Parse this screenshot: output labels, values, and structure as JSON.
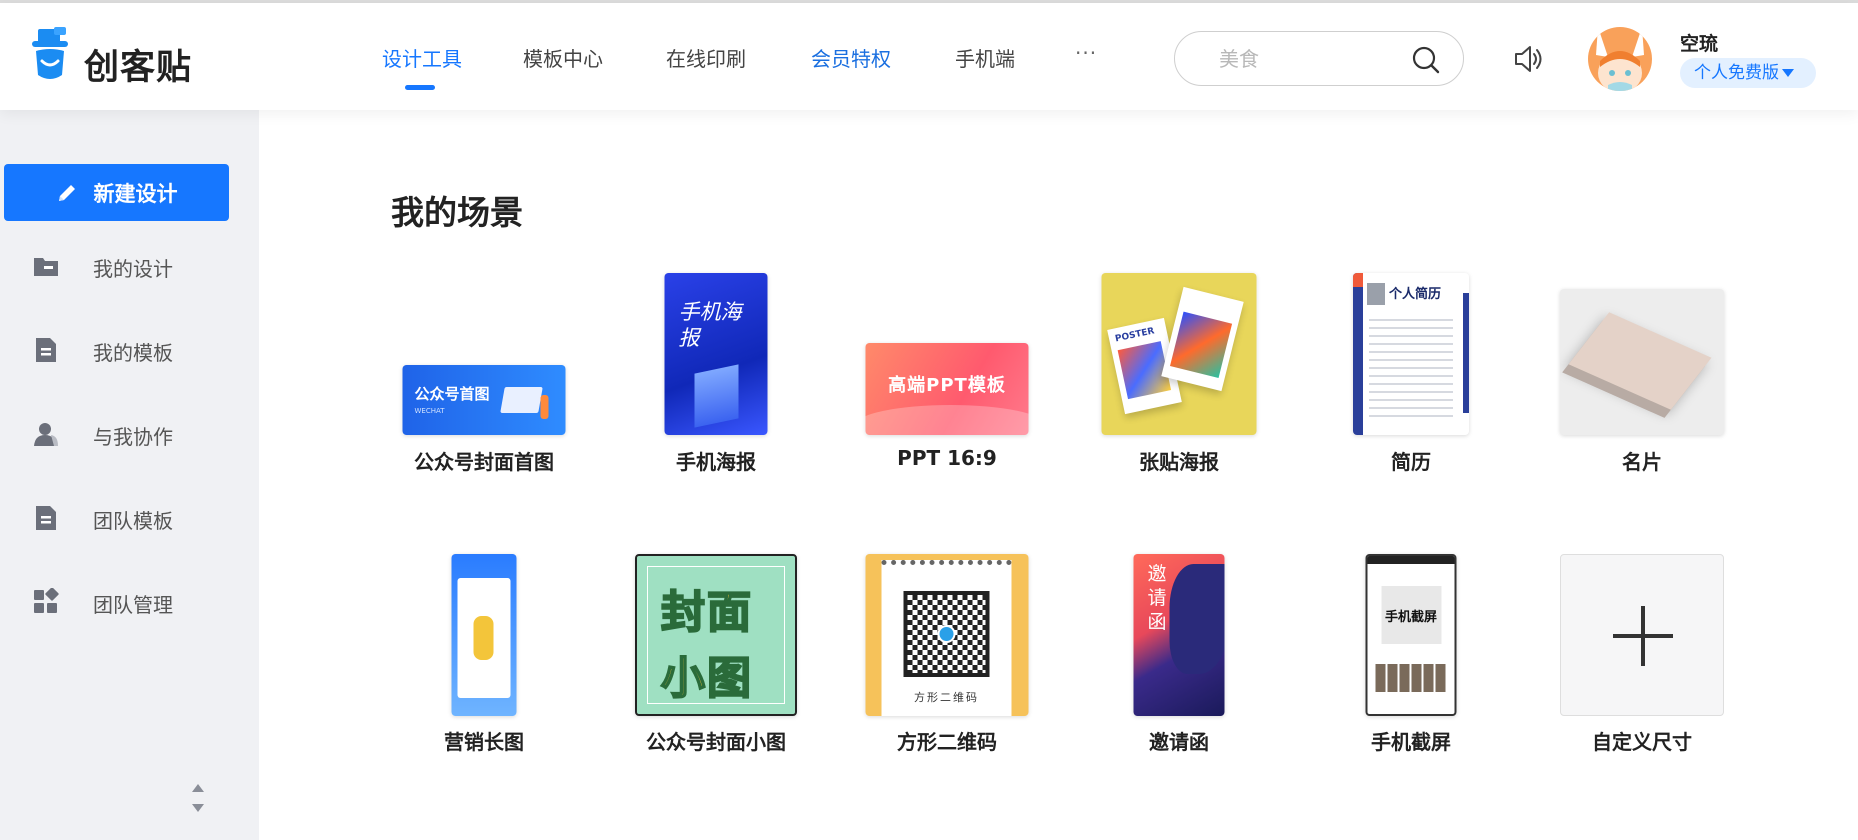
{
  "app": {
    "logo_text": "创客贴"
  },
  "nav": {
    "items": [
      {
        "label": "设计工具"
      },
      {
        "label": "模板中心"
      },
      {
        "label": "在线印刷"
      },
      {
        "label": "会员特权"
      },
      {
        "label": "手机端"
      }
    ],
    "more": "···"
  },
  "search": {
    "placeholder": "美食"
  },
  "user": {
    "name": "空琉",
    "plan": "个人免费版"
  },
  "sidebar": {
    "new_design": "新建设计",
    "items": [
      {
        "label": "我的设计",
        "icon": "folder-icon"
      },
      {
        "label": "我的模板",
        "icon": "document-icon"
      },
      {
        "label": "与我协作",
        "icon": "user-icon"
      },
      {
        "label": "团队模板",
        "icon": "document-icon"
      },
      {
        "label": "团队管理",
        "icon": "grid-icon"
      }
    ]
  },
  "main": {
    "title": "我的场景",
    "scenes": [
      {
        "label": "公众号封面首图",
        "thumb_text": "公众号首图",
        "thumb_sub": "WECHAT"
      },
      {
        "label": "手机海报",
        "thumb_text": "手机海报"
      },
      {
        "label": "PPT 16:9",
        "thumb_text": "高端PPT模板"
      },
      {
        "label": "张贴海报",
        "thumb_text": "POSTER"
      },
      {
        "label": "简历",
        "thumb_text": "个人简历"
      },
      {
        "label": "名片"
      },
      {
        "label": "营销长图"
      },
      {
        "label": "公众号封面小图",
        "thumb_text_1": "封面",
        "thumb_text_2": "小图"
      },
      {
        "label": "方形二维码",
        "thumb_text": "方形二维码"
      },
      {
        "label": "邀请函",
        "thumb_text": "邀请函"
      },
      {
        "label": "手机截屏",
        "thumb_text": "手机截屏"
      },
      {
        "label": "自定义尺寸"
      }
    ]
  },
  "colors": {
    "accent": "#1677ff",
    "sidebar_bg": "#f0f1f4"
  }
}
